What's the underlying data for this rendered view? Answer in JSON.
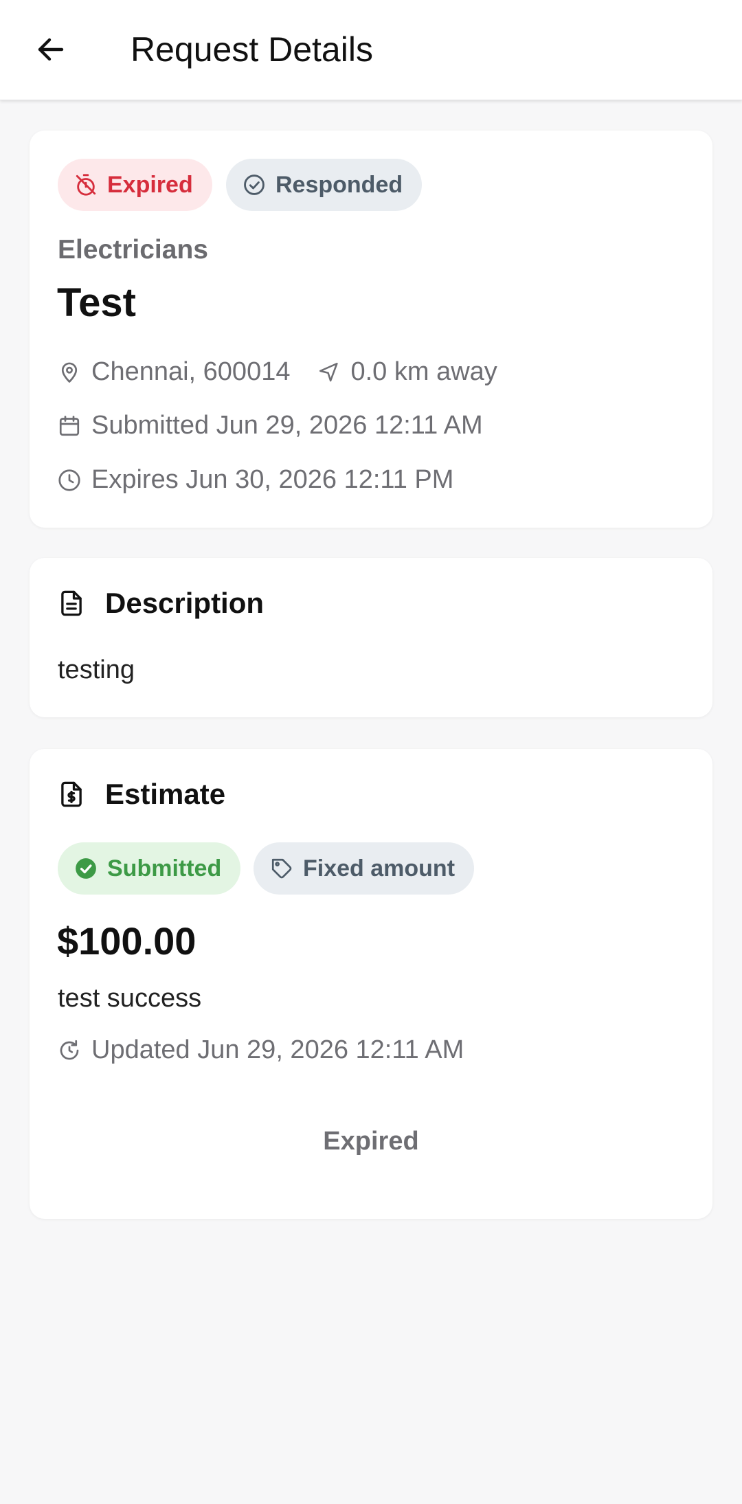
{
  "header": {
    "title": "Request Details",
    "back_icon": "arrow-left-icon"
  },
  "request": {
    "status_chips": [
      {
        "label": "Expired",
        "icon": "timer-off-icon",
        "color": "#d62d3c"
      },
      {
        "label": "Responded",
        "icon": "check-circle-icon",
        "color": "#4d5b68"
      }
    ],
    "category": "Electricians",
    "title": "Test",
    "location": "Chennai, 600014",
    "distance": "0.0 km away",
    "submitted": "Submitted Jun 29, 2026 12:11 AM",
    "expires": "Expires Jun 30, 2026 12:11 PM"
  },
  "description": {
    "heading": "Description",
    "text": "testing"
  },
  "estimate": {
    "heading": "Estimate",
    "chips": [
      {
        "label": "Submitted",
        "icon": "check-circle-filled-icon",
        "color": "#3d9a46"
      },
      {
        "label": "Fixed amount",
        "icon": "tag-icon",
        "color": "#4d5b68"
      }
    ],
    "amount": "$100.00",
    "note": "test success",
    "updated": "Updated Jun 29, 2026 12:11 AM",
    "status_text": "Expired"
  }
}
